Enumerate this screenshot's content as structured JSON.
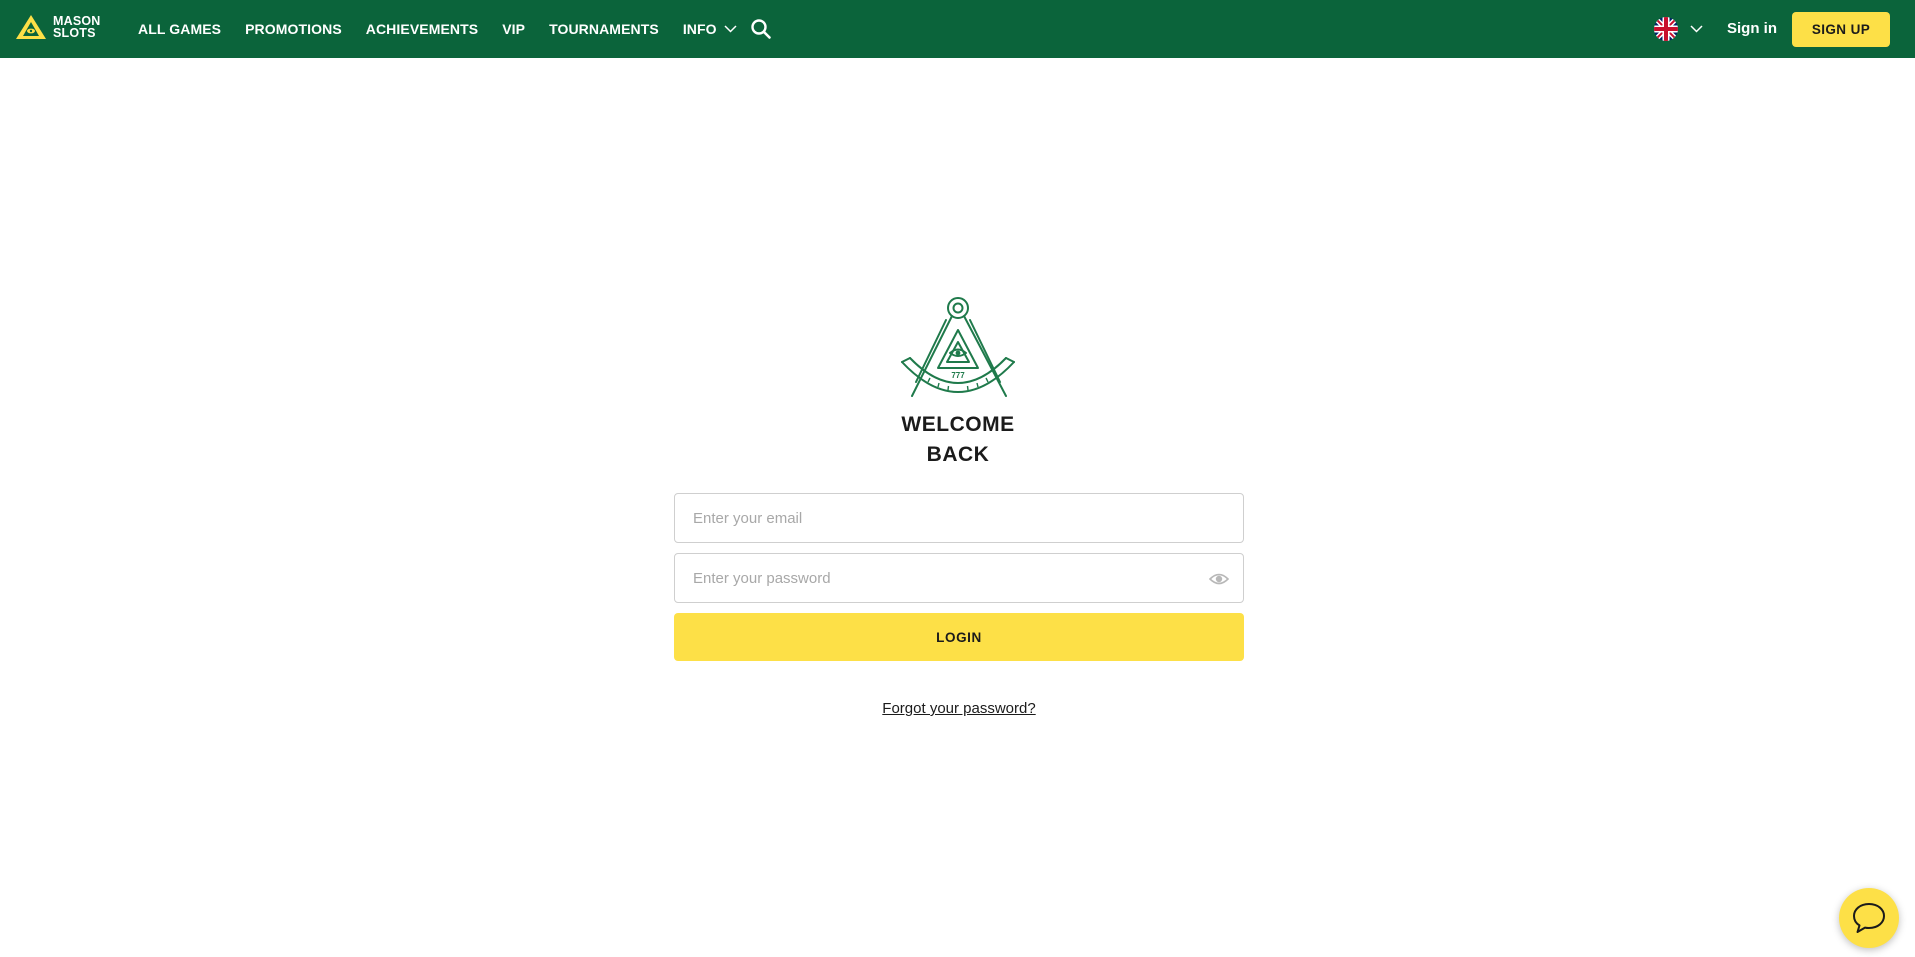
{
  "brand": {
    "line1": "MASON",
    "line2": "SLOTS",
    "icon": "mason-pyramid-logo-icon"
  },
  "nav": {
    "items": [
      {
        "label": "ALL GAMES"
      },
      {
        "label": "PROMOTIONS"
      },
      {
        "label": "ACHIEVEMENTS"
      },
      {
        "label": "VIP"
      },
      {
        "label": "TOURNAMENTS"
      },
      {
        "label": "INFO",
        "has_dropdown": true
      }
    ],
    "search_icon": "search-icon"
  },
  "header_right": {
    "language_icon": "uk-flag-icon",
    "signin_label": "Sign in",
    "signup_label": "SIGN UP"
  },
  "login": {
    "emblem_icon": "square-and-compass-emblem-icon",
    "title_line1": "WELCOME",
    "title_line2": "BACK",
    "email_placeholder": "Enter your email",
    "email_value": "",
    "password_placeholder": "Enter your password",
    "password_value": "",
    "login_label": "LOGIN",
    "forgot_label": "Forgot your password?"
  },
  "chat": {
    "icon": "chat-bubble-icon"
  },
  "colors": {
    "header_bg": "#0b643b",
    "accent_yellow": "#fde047",
    "emblem_green": "#1f7a4b",
    "text_dark": "#1b1b1b"
  }
}
